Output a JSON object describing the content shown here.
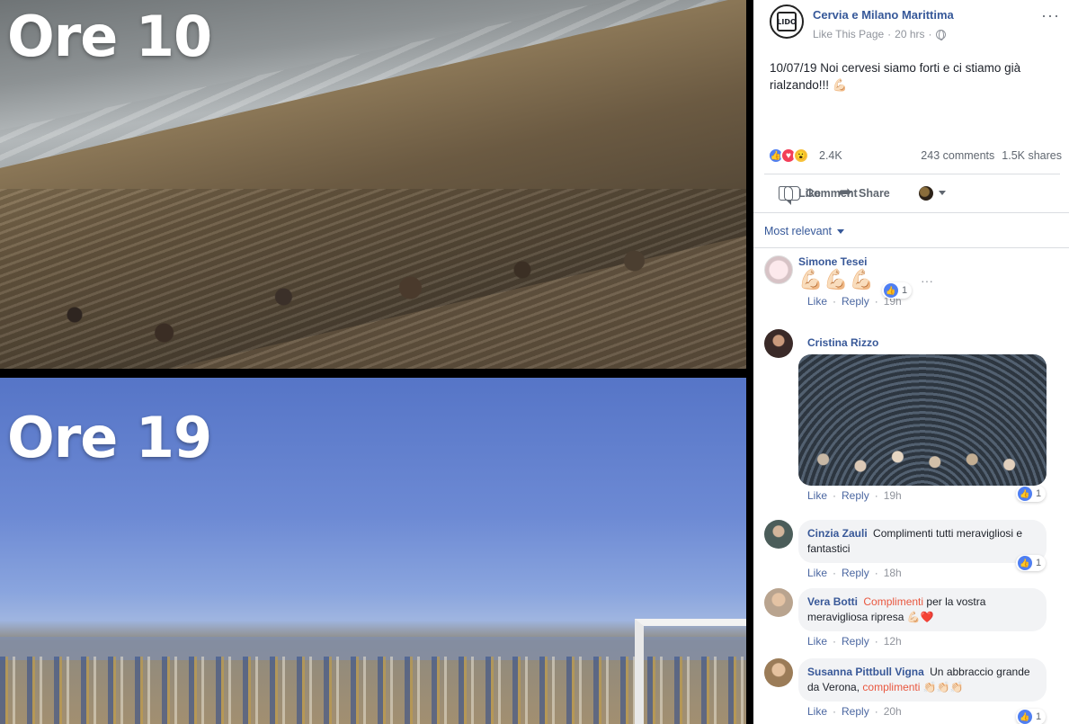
{
  "media": {
    "top_label": "Ore 10",
    "bottom_label": "Ore 19"
  },
  "post": {
    "page_name": "Cervia e Milano Marittima",
    "like_page": "Like This Page",
    "time": "20 hrs",
    "avatar_text": "LIDO",
    "text": "10/07/19 Noi cervesi siamo forti e ci stiamo già rialzando!!! 💪🏻",
    "reaction_count": "2.4K",
    "comments": "243 comments",
    "shares": "1.5K shares",
    "actions": {
      "like": "Like",
      "comment": "Comment",
      "share": "Share"
    },
    "sort_label": "Most relevant"
  },
  "comments": [
    {
      "author": "Simone Tesei",
      "text": "💪🏻💪🏻💪🏻",
      "like": "Like",
      "reply": "Reply",
      "time": "19h",
      "reactions": "1"
    },
    {
      "author": "Cristina Rizzo",
      "text": "",
      "like": "Like",
      "reply": "Reply",
      "time": "19h",
      "reactions": "1"
    },
    {
      "author": "Cinzia Zauli",
      "text": "Complimenti tutti meravigliosi e fantastici",
      "like": "Like",
      "reply": "Reply",
      "time": "18h",
      "reactions": "1"
    },
    {
      "author": "Vera Botti",
      "highlight": "Complimenti",
      "text": "per la vostra meravigliosa ripresa 💪🏻❤️",
      "like": "Like",
      "reply": "Reply",
      "time": "12h"
    },
    {
      "author": "Susanna Pittbull Vigna",
      "text_a": "Un abbraccio grande da Verona,",
      "highlight": "complimenti",
      "text_b": "👏🏻👏🏻👏🏻",
      "like": "Like",
      "reply": "Reply",
      "time": "20h",
      "reactions": "1"
    }
  ],
  "colors": {
    "link": "#385898",
    "highlight": "#e9573f",
    "like_blue": "#4f7ff2"
  },
  "icons": [
    "more-icon",
    "globe-icon",
    "like-icon",
    "comment-icon",
    "share-icon",
    "caret-down-icon"
  ]
}
